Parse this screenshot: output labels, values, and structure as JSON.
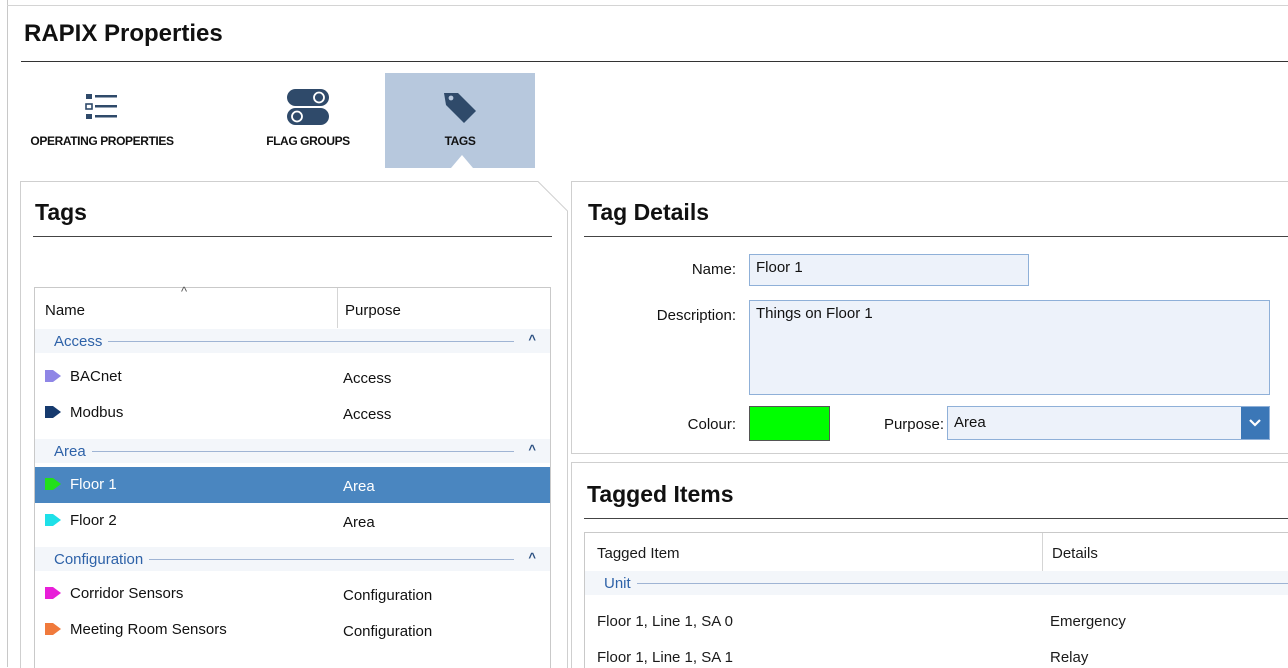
{
  "app": {
    "title": "RAPIX Properties"
  },
  "toolbar": {
    "items": [
      {
        "label": "OPERATING PROPERTIES",
        "icon": "list-icon",
        "active": false
      },
      {
        "label": "FLAG GROUPS",
        "icon": "toggle-icon",
        "active": false
      },
      {
        "label": "TAGS",
        "icon": "tag-icon",
        "active": true
      }
    ]
  },
  "tags_panel": {
    "title": "Tags",
    "columns": {
      "name": "Name",
      "purpose": "Purpose"
    },
    "groups": [
      {
        "label": "Access",
        "items": [
          {
            "name": "BACnet",
            "purpose": "Access",
            "color": "#8f86e6"
          },
          {
            "name": "Modbus",
            "purpose": "Access",
            "color": "#163a6e"
          }
        ]
      },
      {
        "label": "Area",
        "items": [
          {
            "name": "Floor 1",
            "purpose": "Area",
            "color": "#22e01a",
            "selected": true
          },
          {
            "name": "Floor 2",
            "purpose": "Area",
            "color": "#1ee0e8"
          }
        ]
      },
      {
        "label": "Configuration",
        "items": [
          {
            "name": "Corridor Sensors",
            "purpose": "Configuration",
            "color": "#e81ed8"
          },
          {
            "name": "Meeting Room Sensors",
            "purpose": "Configuration",
            "color": "#f07a3c"
          }
        ]
      }
    ]
  },
  "tag_details": {
    "title": "Tag Details",
    "name_label": "Name:",
    "name_value": "Floor 1",
    "description_label": "Description:",
    "description_value": "Things on Floor 1",
    "colour_label": "Colour:",
    "colour_value": "#00ff00",
    "purpose_label": "Purpose:",
    "purpose_value": "Area"
  },
  "tagged_items": {
    "title": "Tagged Items",
    "columns": {
      "item": "Tagged Item",
      "details": "Details"
    },
    "group": "Unit",
    "rows": [
      {
        "item": "Floor 1, Line 1, SA 0",
        "details": "Emergency"
      },
      {
        "item": "Floor 1, Line 1, SA 1",
        "details": "Relay"
      }
    ]
  }
}
